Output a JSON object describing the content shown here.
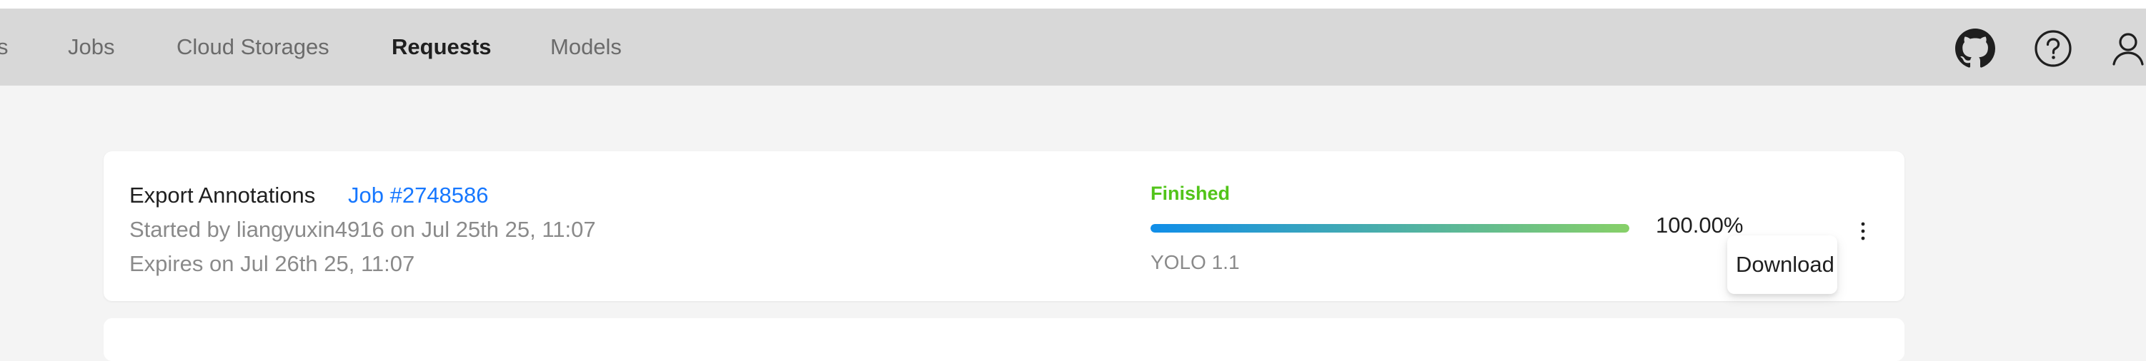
{
  "nav": {
    "items": [
      {
        "label": "s"
      },
      {
        "label": "Jobs"
      },
      {
        "label": "Cloud Storages"
      },
      {
        "label": "Requests",
        "active": true
      },
      {
        "label": "Models"
      }
    ]
  },
  "header_icons": [
    "github-icon",
    "help-icon",
    "user-icon"
  ],
  "request": {
    "type": "Export Annotations",
    "job_link": "Job #2748586",
    "started": "Started by liangyuxin4916 on Jul 25th 25, 11:07",
    "expires": "Expires on Jul 26th 25, 11:07",
    "status": "Finished",
    "status_color": "#52c41a",
    "progress_fraction": 1.0,
    "progress_text": "100.00%",
    "format": "YOLO 1.1",
    "progress_gradient": [
      "#108ee9",
      "#87d068"
    ]
  },
  "actions_menu": {
    "icon": "more-vertical-icon",
    "items": [
      {
        "label": "Download"
      }
    ]
  },
  "colors": {
    "header_bg": "#d8d8d8",
    "page_bg": "#f4f4f4",
    "link": "#1677ff"
  }
}
